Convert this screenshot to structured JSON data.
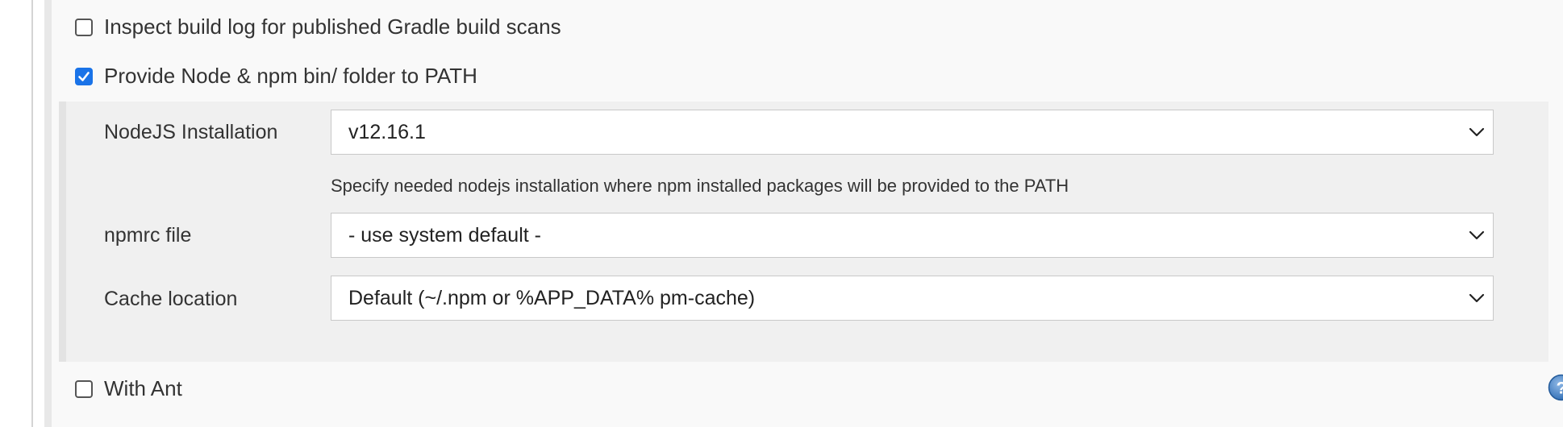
{
  "options": {
    "inspect_gradle": {
      "label": "Inspect build log for published Gradle build scans",
      "checked": false
    },
    "provide_node": {
      "label": "Provide Node & npm bin/ folder to PATH",
      "checked": true
    },
    "with_ant": {
      "label": "With Ant",
      "checked": false
    }
  },
  "node_config": {
    "nodejs_installation": {
      "label": "NodeJS Installation",
      "value": "v12.16.1",
      "help": "Specify needed nodejs installation where npm installed packages will be provided to the PATH"
    },
    "npmrc_file": {
      "label": "npmrc file",
      "value": "- use system default -"
    },
    "cache_location": {
      "label": "Cache location",
      "value": "Default (~/.npm or %APP_DATA% pm-cache)"
    }
  },
  "icons": {
    "chevron": "chevron-down-icon",
    "help": "help-icon",
    "check": "checkmark-icon"
  },
  "colors": {
    "checkbox_checked": "#1a73e8",
    "help_icon": "#3d7fc1"
  }
}
